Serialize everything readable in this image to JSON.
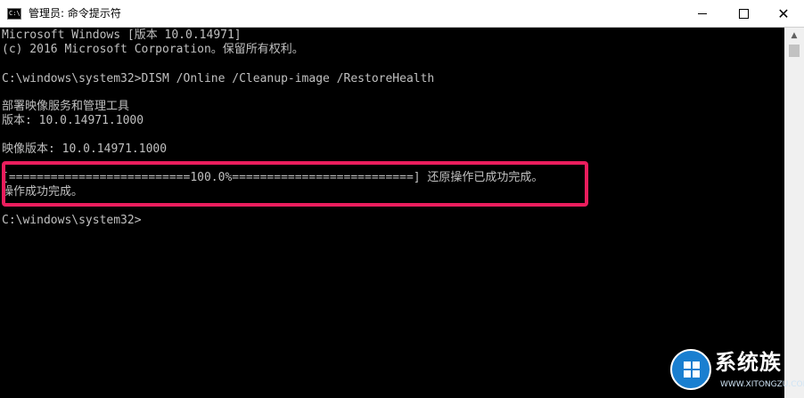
{
  "window": {
    "title": "管理员: 命令提示符",
    "icon_text": "C:\\"
  },
  "titlebar_controls": {
    "minimize": "minimize-icon",
    "maximize": "maximize-icon",
    "close": "close-icon"
  },
  "console": {
    "lines": [
      "Microsoft Windows [版本 10.0.14971]",
      "(c) 2016 Microsoft Corporation。保留所有权利。",
      "",
      "C:\\windows\\system32>DISM /Online /Cleanup-image /RestoreHealth",
      "",
      "部署映像服务和管理工具",
      "版本: 10.0.14971.1000",
      "",
      "映像版本: 10.0.14971.1000",
      "",
      "[==========================100.0%==========================] 还原操作已成功完成。",
      "操作成功完成。",
      "",
      "C:\\windows\\system32>"
    ]
  },
  "colors": {
    "console_bg": "#000000",
    "console_text": "#c0c0c0",
    "highlight_border": "#ea1d5d"
  },
  "watermark": {
    "brand": "系统族",
    "url": "WWW.XITONGZU.COM"
  }
}
